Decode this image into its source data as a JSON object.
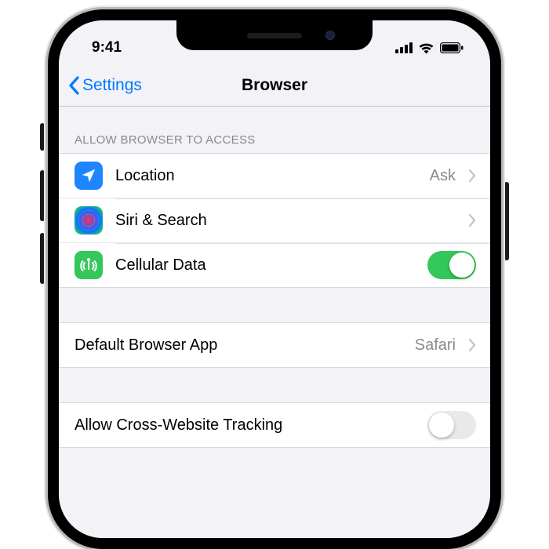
{
  "status": {
    "time": "9:41"
  },
  "nav": {
    "back_label": "Settings",
    "title": "Browser"
  },
  "section1": {
    "header": "Allow Browser to Access",
    "location": {
      "label": "Location",
      "value": "Ask"
    },
    "siri": {
      "label": "Siri & Search"
    },
    "cellular": {
      "label": "Cellular Data",
      "enabled": true
    }
  },
  "section2": {
    "default_browser": {
      "label": "Default Browser App",
      "value": "Safari"
    }
  },
  "section3": {
    "cross_tracking": {
      "label": "Allow Cross-Website Tracking",
      "enabled": false
    }
  }
}
